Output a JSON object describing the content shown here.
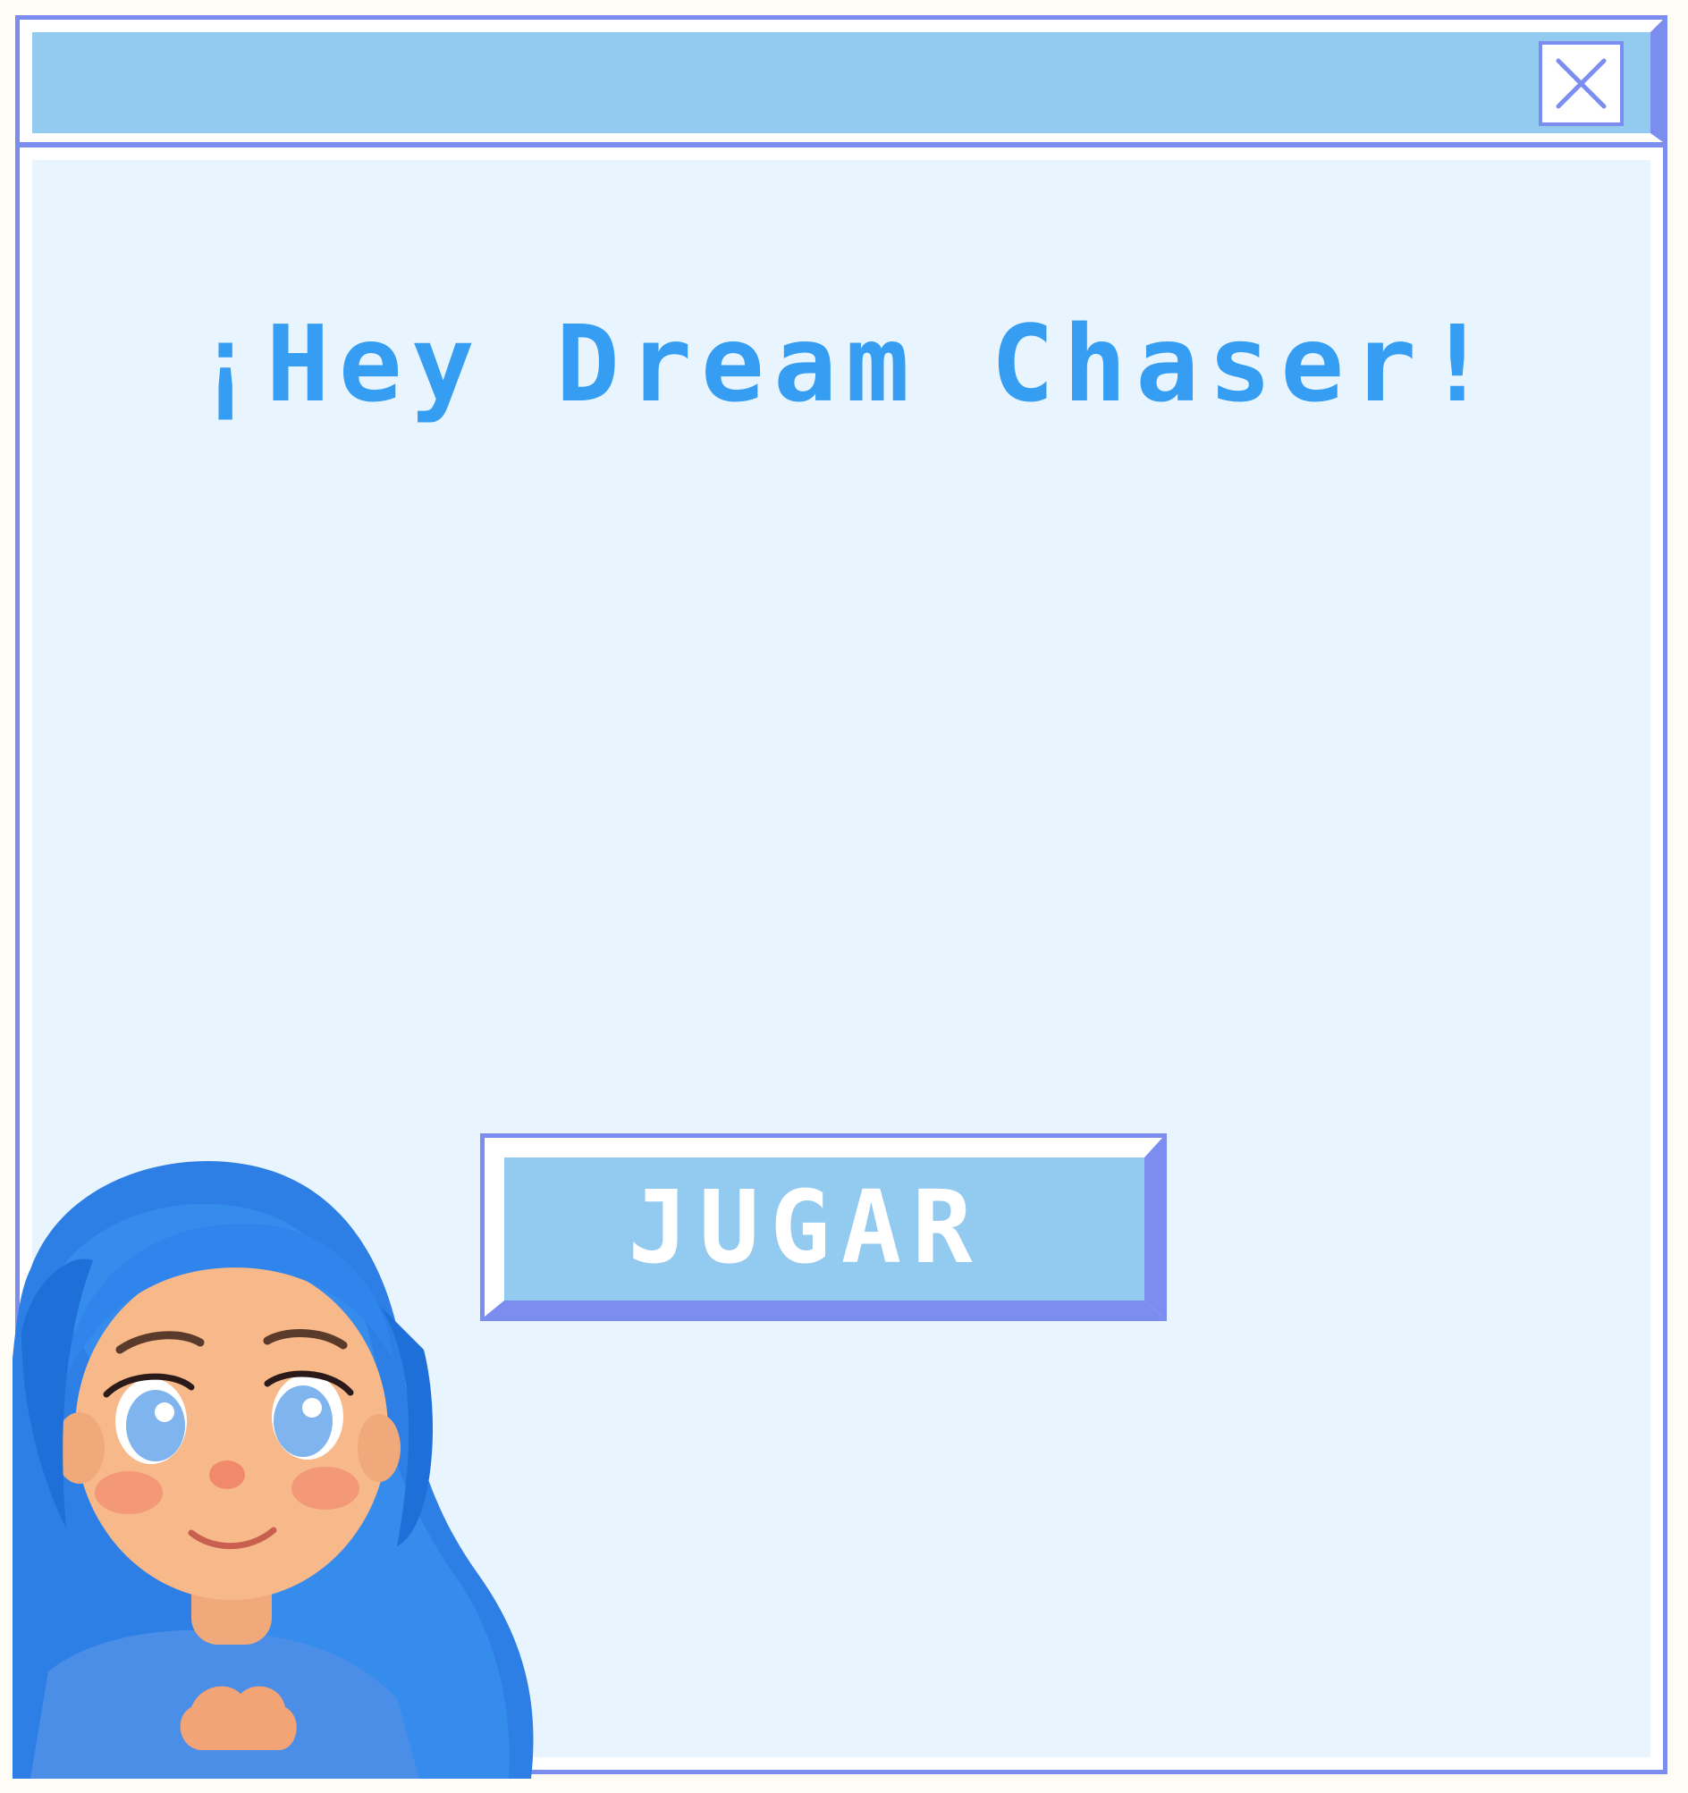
{
  "window": {
    "heading": "¡Hey Dream Chaser!",
    "close_icon": "close-icon",
    "play_label": "JUGAR"
  },
  "colors": {
    "frame": "#7b8ef0",
    "titlebar": "#93caef",
    "content_bg": "#e9f5fe",
    "heading_text": "#359df2",
    "button_face": "#93caef",
    "button_text": "#ffffff",
    "page_bg": "#fffdf5"
  },
  "character": {
    "icon": "blue-haired-girl-avatar"
  }
}
